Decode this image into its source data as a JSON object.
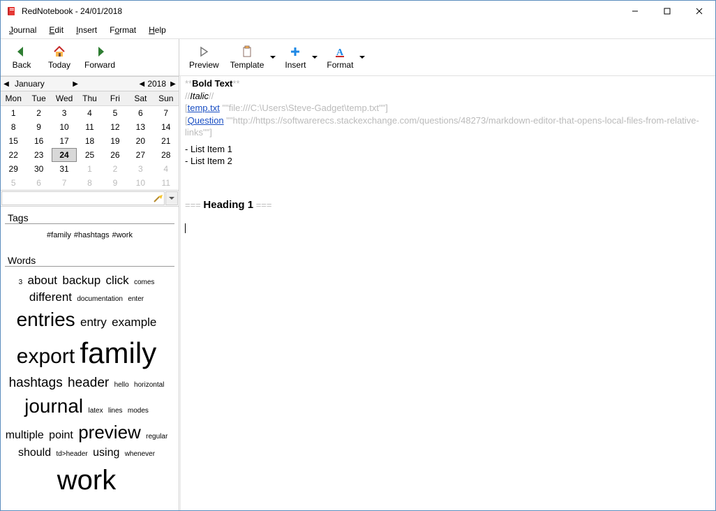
{
  "title": "RedNotebook - 24/01/2018",
  "menu": {
    "journal": "Journal",
    "edit": "Edit",
    "insert": "Insert",
    "format": "Format",
    "help": "Help"
  },
  "nav": {
    "back": "Back",
    "today": "Today",
    "forward": "Forward"
  },
  "etb": {
    "preview": "Preview",
    "template": "Template",
    "insert": "Insert",
    "format": "Format"
  },
  "month": {
    "name": "January",
    "year": "2018"
  },
  "dow": [
    "Mon",
    "Tue",
    "Wed",
    "Thu",
    "Fri",
    "Sat",
    "Sun"
  ],
  "cal": [
    {
      "d": "1"
    },
    {
      "d": "2"
    },
    {
      "d": "3"
    },
    {
      "d": "4"
    },
    {
      "d": "5"
    },
    {
      "d": "6"
    },
    {
      "d": "7"
    },
    {
      "d": "8"
    },
    {
      "d": "9"
    },
    {
      "d": "10"
    },
    {
      "d": "11"
    },
    {
      "d": "12"
    },
    {
      "d": "13"
    },
    {
      "d": "14"
    },
    {
      "d": "15"
    },
    {
      "d": "16"
    },
    {
      "d": "17"
    },
    {
      "d": "18"
    },
    {
      "d": "19"
    },
    {
      "d": "20"
    },
    {
      "d": "21"
    },
    {
      "d": "22"
    },
    {
      "d": "23"
    },
    {
      "d": "24",
      "today": true
    },
    {
      "d": "25"
    },
    {
      "d": "26"
    },
    {
      "d": "27"
    },
    {
      "d": "28"
    },
    {
      "d": "29"
    },
    {
      "d": "30"
    },
    {
      "d": "31"
    },
    {
      "d": "1",
      "other": true
    },
    {
      "d": "2",
      "other": true
    },
    {
      "d": "3",
      "other": true
    },
    {
      "d": "4",
      "other": true
    },
    {
      "d": "5",
      "other": true
    },
    {
      "d": "6",
      "other": true
    },
    {
      "d": "7",
      "other": true
    },
    {
      "d": "8",
      "other": true
    },
    {
      "d": "9",
      "other": true
    },
    {
      "d": "10",
      "other": true
    },
    {
      "d": "11",
      "other": true
    }
  ],
  "sections": {
    "tags": "Tags",
    "words": "Words"
  },
  "tags": [
    "#family",
    "#hashtags",
    "#work"
  ],
  "words": [
    {
      "t": "3",
      "s": 10
    },
    {
      "t": "about",
      "s": 17
    },
    {
      "t": "backup",
      "s": 17
    },
    {
      "t": "click",
      "s": 17
    },
    {
      "t": "comes",
      "s": 10
    },
    {
      "t": "different",
      "s": 17
    },
    {
      "t": "documentation",
      "s": 10
    },
    {
      "t": "enter",
      "s": 10
    },
    {
      "t": "entries",
      "s": 28
    },
    {
      "t": "entry",
      "s": 17
    },
    {
      "t": "example",
      "s": 17
    },
    {
      "t": "export",
      "s": 30
    },
    {
      "t": "family",
      "s": 42
    },
    {
      "t": "hashtags",
      "s": 19
    },
    {
      "t": "header",
      "s": 19
    },
    {
      "t": "hello",
      "s": 10
    },
    {
      "t": "horizontal",
      "s": 10
    },
    {
      "t": "journal",
      "s": 28
    },
    {
      "t": "latex",
      "s": 10
    },
    {
      "t": "lines",
      "s": 10
    },
    {
      "t": "modes",
      "s": 10
    },
    {
      "t": "multiple",
      "s": 16
    },
    {
      "t": "point",
      "s": 16
    },
    {
      "t": "preview",
      "s": 26
    },
    {
      "t": "regular",
      "s": 10
    },
    {
      "t": "should",
      "s": 16
    },
    {
      "t": "td>header",
      "s": 10
    },
    {
      "t": "using",
      "s": 16
    },
    {
      "t": "whenever",
      "s": 10
    },
    {
      "t": "work",
      "s": 40
    }
  ],
  "editor": {
    "bold_marks": "**",
    "bold_text": "Bold Text",
    "italic_marks": "//",
    "italic_text": "Italic",
    "link1_open": "[",
    "link1_text": "temp.txt",
    "link1_url": " \"\"file:///C:\\Users\\Steve-Gadget\\temp.txt\"\"]",
    "link2_open": "[",
    "link2_text": "Question",
    "link2_url": " \"\"http://https://softwarerecs.stackexchange.com/questions/48273/markdown-editor-that-opens-local-files-from-relative-links\"\"]",
    "list1": "- List Item 1",
    "list2": "- List Item 2",
    "h_pre": "=== ",
    "h_text": "Heading 1",
    "h_post": " ==="
  }
}
